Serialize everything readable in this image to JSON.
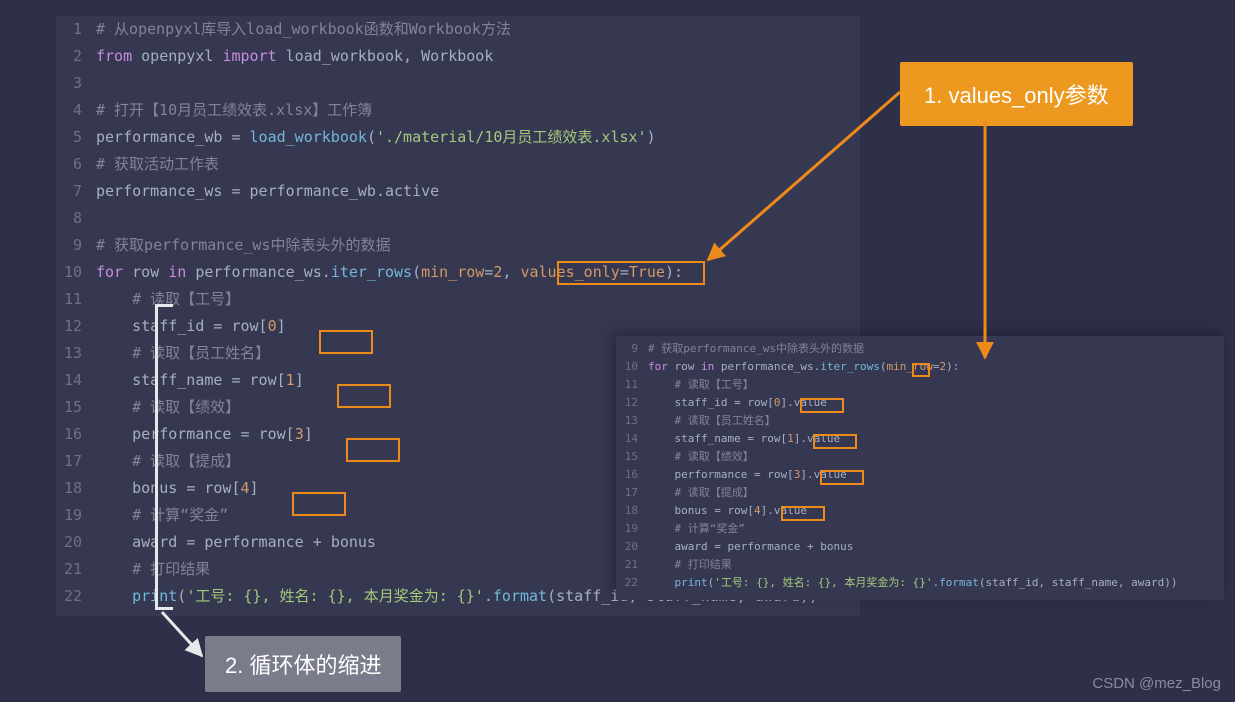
{
  "main": {
    "lines": [
      {
        "n": "1",
        "segs": [
          {
            "c": "cm",
            "t": "# 从openpyxl库导入load_workbook函数和Workbook方法"
          }
        ]
      },
      {
        "n": "2",
        "segs": [
          {
            "c": "kw",
            "t": "from"
          },
          {
            "c": "pn",
            "t": " openpyxl "
          },
          {
            "c": "kw",
            "t": "import"
          },
          {
            "c": "pn",
            "t": " load_workbook, Workbook"
          }
        ]
      },
      {
        "n": "3",
        "segs": [
          {
            "c": "pn",
            "t": ""
          }
        ]
      },
      {
        "n": "4",
        "segs": [
          {
            "c": "cm",
            "t": "# 打开【10月员工绩效表.xlsx】工作簿"
          }
        ]
      },
      {
        "n": "5",
        "segs": [
          {
            "c": "pn",
            "t": "performance_wb "
          },
          {
            "c": "op",
            "t": "= "
          },
          {
            "c": "fn",
            "t": "load_workbook"
          },
          {
            "c": "pn",
            "t": "("
          },
          {
            "c": "st",
            "t": "'./material/10月员工绩效表.xlsx'"
          },
          {
            "c": "pn",
            "t": ")"
          }
        ]
      },
      {
        "n": "6",
        "segs": [
          {
            "c": "cm",
            "t": "# 获取活动工作表"
          }
        ]
      },
      {
        "n": "7",
        "segs": [
          {
            "c": "pn",
            "t": "performance_ws "
          },
          {
            "c": "op",
            "t": "= "
          },
          {
            "c": "pn",
            "t": "performance_wb"
          },
          {
            "c": "op",
            "t": "."
          },
          {
            "c": "pn",
            "t": "active"
          }
        ]
      },
      {
        "n": "8",
        "segs": [
          {
            "c": "pn",
            "t": ""
          }
        ]
      },
      {
        "n": "9",
        "segs": [
          {
            "c": "cm",
            "t": "# 获取performance_ws中除表头外的数据"
          }
        ]
      },
      {
        "n": "10",
        "segs": [
          {
            "c": "kw",
            "t": "for"
          },
          {
            "c": "pn",
            "t": " row "
          },
          {
            "c": "kw",
            "t": "in"
          },
          {
            "c": "pn",
            "t": " performance_ws"
          },
          {
            "c": "op",
            "t": "."
          },
          {
            "c": "fn",
            "t": "iter_rows"
          },
          {
            "c": "pn",
            "t": "("
          },
          {
            "c": "pa",
            "t": "min_row"
          },
          {
            "c": "op",
            "t": "="
          },
          {
            "c": "nm",
            "t": "2"
          },
          {
            "c": "pn",
            "t": ", "
          },
          {
            "c": "pa",
            "t": "values_only"
          },
          {
            "c": "op",
            "t": "="
          },
          {
            "c": "tf",
            "t": "True"
          },
          {
            "c": "pn",
            "t": "):"
          }
        ]
      },
      {
        "n": "11",
        "segs": [
          {
            "c": "pn",
            "t": "    "
          },
          {
            "c": "cm",
            "t": "# 读取【工号】"
          }
        ]
      },
      {
        "n": "12",
        "segs": [
          {
            "c": "pn",
            "t": "    staff_id "
          },
          {
            "c": "op",
            "t": "= "
          },
          {
            "c": "pn",
            "t": "row["
          },
          {
            "c": "nm",
            "t": "0"
          },
          {
            "c": "pn",
            "t": "]"
          }
        ]
      },
      {
        "n": "13",
        "segs": [
          {
            "c": "pn",
            "t": "    "
          },
          {
            "c": "cm",
            "t": "# 读取【员工姓名】"
          }
        ]
      },
      {
        "n": "14",
        "segs": [
          {
            "c": "pn",
            "t": "    staff_name "
          },
          {
            "c": "op",
            "t": "= "
          },
          {
            "c": "pn",
            "t": "row["
          },
          {
            "c": "nm",
            "t": "1"
          },
          {
            "c": "pn",
            "t": "]"
          }
        ]
      },
      {
        "n": "15",
        "segs": [
          {
            "c": "pn",
            "t": "    "
          },
          {
            "c": "cm",
            "t": "# 读取【绩效】"
          }
        ]
      },
      {
        "n": "16",
        "segs": [
          {
            "c": "pn",
            "t": "    performance "
          },
          {
            "c": "op",
            "t": "= "
          },
          {
            "c": "pn",
            "t": "row["
          },
          {
            "c": "nm",
            "t": "3"
          },
          {
            "c": "pn",
            "t": "]"
          }
        ]
      },
      {
        "n": "17",
        "segs": [
          {
            "c": "pn",
            "t": "    "
          },
          {
            "c": "cm",
            "t": "# 读取【提成】"
          }
        ]
      },
      {
        "n": "18",
        "segs": [
          {
            "c": "pn",
            "t": "    bonus "
          },
          {
            "c": "op",
            "t": "= "
          },
          {
            "c": "pn",
            "t": "row["
          },
          {
            "c": "nm",
            "t": "4"
          },
          {
            "c": "pn",
            "t": "]"
          }
        ]
      },
      {
        "n": "19",
        "segs": [
          {
            "c": "pn",
            "t": "    "
          },
          {
            "c": "cm",
            "t": "# 计算“奖金”"
          }
        ]
      },
      {
        "n": "20",
        "segs": [
          {
            "c": "pn",
            "t": "    award "
          },
          {
            "c": "op",
            "t": "= "
          },
          {
            "c": "pn",
            "t": "performance "
          },
          {
            "c": "op",
            "t": "+ "
          },
          {
            "c": "pn",
            "t": "bonus"
          }
        ]
      },
      {
        "n": "21",
        "segs": [
          {
            "c": "pn",
            "t": "    "
          },
          {
            "c": "cm",
            "t": "# 打印结果"
          }
        ]
      },
      {
        "n": "22",
        "segs": [
          {
            "c": "pn",
            "t": "    "
          },
          {
            "c": "fn",
            "t": "print"
          },
          {
            "c": "pn",
            "t": "("
          },
          {
            "c": "st",
            "t": "'工号: {}, 姓名: {}, 本月奖金为: {}'"
          },
          {
            "c": "op",
            "t": "."
          },
          {
            "c": "fn",
            "t": "format"
          },
          {
            "c": "pn",
            "t": "(staff_id, staff_name, award))"
          }
        ]
      }
    ]
  },
  "small": {
    "lines": [
      {
        "n": "9",
        "segs": [
          {
            "c": "cm",
            "t": "# 获取performance_ws中除表头外的数据"
          }
        ]
      },
      {
        "n": "10",
        "segs": [
          {
            "c": "kw",
            "t": "for"
          },
          {
            "c": "pn",
            "t": " row "
          },
          {
            "c": "kw",
            "t": "in"
          },
          {
            "c": "pn",
            "t": " performance_ws"
          },
          {
            "c": "op",
            "t": "."
          },
          {
            "c": "fn",
            "t": "iter_rows"
          },
          {
            "c": "pn",
            "t": "("
          },
          {
            "c": "pa",
            "t": "min_row"
          },
          {
            "c": "op",
            "t": "="
          },
          {
            "c": "nm",
            "t": "2"
          },
          {
            "c": "pn",
            "t": "):"
          }
        ]
      },
      {
        "n": "11",
        "segs": [
          {
            "c": "pn",
            "t": "    "
          },
          {
            "c": "cm",
            "t": "# 读取【工号】"
          }
        ]
      },
      {
        "n": "12",
        "segs": [
          {
            "c": "pn",
            "t": "    staff_id "
          },
          {
            "c": "op",
            "t": "= "
          },
          {
            "c": "pn",
            "t": "row["
          },
          {
            "c": "nm",
            "t": "0"
          },
          {
            "c": "pn",
            "t": "]"
          },
          {
            "c": "op",
            "t": "."
          },
          {
            "c": "pn",
            "t": "value"
          }
        ]
      },
      {
        "n": "13",
        "segs": [
          {
            "c": "pn",
            "t": "    "
          },
          {
            "c": "cm",
            "t": "# 读取【员工姓名】"
          }
        ]
      },
      {
        "n": "14",
        "segs": [
          {
            "c": "pn",
            "t": "    staff_name "
          },
          {
            "c": "op",
            "t": "= "
          },
          {
            "c": "pn",
            "t": "row["
          },
          {
            "c": "nm",
            "t": "1"
          },
          {
            "c": "pn",
            "t": "]"
          },
          {
            "c": "op",
            "t": "."
          },
          {
            "c": "pn",
            "t": "value"
          }
        ]
      },
      {
        "n": "15",
        "segs": [
          {
            "c": "pn",
            "t": "    "
          },
          {
            "c": "cm",
            "t": "# 读取【绩效】"
          }
        ]
      },
      {
        "n": "16",
        "segs": [
          {
            "c": "pn",
            "t": "    performance "
          },
          {
            "c": "op",
            "t": "= "
          },
          {
            "c": "pn",
            "t": "row["
          },
          {
            "c": "nm",
            "t": "3"
          },
          {
            "c": "pn",
            "t": "]"
          },
          {
            "c": "op",
            "t": "."
          },
          {
            "c": "pn",
            "t": "value"
          }
        ]
      },
      {
        "n": "17",
        "segs": [
          {
            "c": "pn",
            "t": "    "
          },
          {
            "c": "cm",
            "t": "# 读取【提成】"
          }
        ]
      },
      {
        "n": "18",
        "segs": [
          {
            "c": "pn",
            "t": "    bonus "
          },
          {
            "c": "op",
            "t": "= "
          },
          {
            "c": "pn",
            "t": "row["
          },
          {
            "c": "nm",
            "t": "4"
          },
          {
            "c": "pn",
            "t": "]"
          },
          {
            "c": "op",
            "t": "."
          },
          {
            "c": "pn",
            "t": "value"
          }
        ]
      },
      {
        "n": "19",
        "segs": [
          {
            "c": "pn",
            "t": "    "
          },
          {
            "c": "cm",
            "t": "# 计算“奖金”"
          }
        ]
      },
      {
        "n": "20",
        "segs": [
          {
            "c": "pn",
            "t": "    award "
          },
          {
            "c": "op",
            "t": "= "
          },
          {
            "c": "pn",
            "t": "performance "
          },
          {
            "c": "op",
            "t": "+ "
          },
          {
            "c": "pn",
            "t": "bonus"
          }
        ]
      },
      {
        "n": "21",
        "segs": [
          {
            "c": "pn",
            "t": "    "
          },
          {
            "c": "cm",
            "t": "# 打印结果"
          }
        ]
      },
      {
        "n": "22",
        "segs": [
          {
            "c": "pn",
            "t": "    "
          },
          {
            "c": "fn",
            "t": "print"
          },
          {
            "c": "pn",
            "t": "("
          },
          {
            "c": "st",
            "t": "'工号: {}, 姓名: {}, 本月奖金为: {}'"
          },
          {
            "c": "op",
            "t": "."
          },
          {
            "c": "fn",
            "t": "format"
          },
          {
            "c": "pn",
            "t": "(staff_id, staff_name, award))"
          }
        ]
      }
    ]
  },
  "callouts": {
    "one": "1. values_only参数",
    "two": "2. 循环体的缩进"
  },
  "watermark": "CSDN @mez_Blog"
}
